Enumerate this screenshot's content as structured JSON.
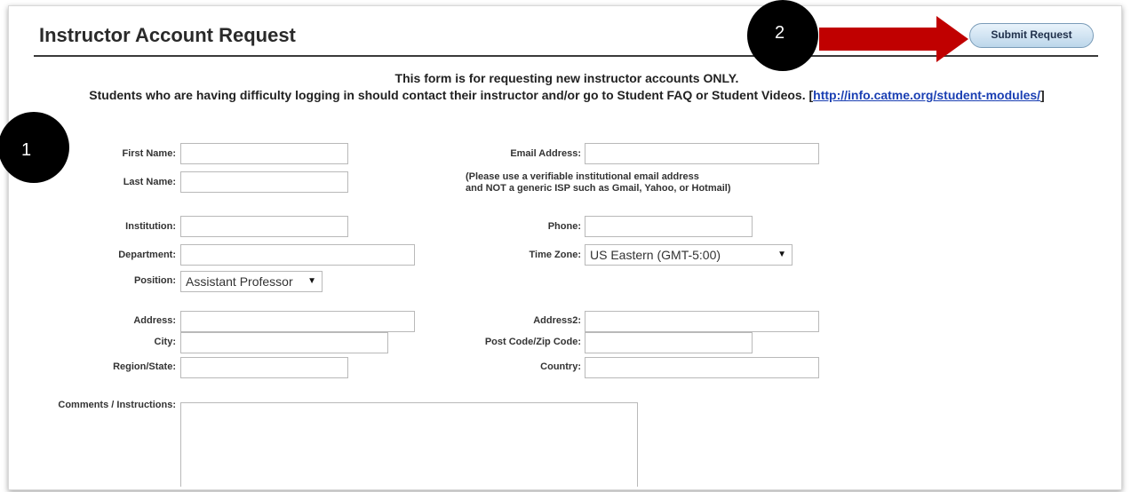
{
  "header": {
    "title": "Instructor Account Request",
    "submit_label": "Submit Request"
  },
  "callouts": {
    "one": "1",
    "two": "2",
    "arrow_color": "#c00000"
  },
  "notice": {
    "line1": "This form is for requesting new instructor accounts ONLY.",
    "line2": "Students who are having difficulty logging in should contact their instructor and/or go to Student FAQ or Student Videos. [",
    "link": "http://info.catme.org/student-modules/",
    "close": "]"
  },
  "form": {
    "first_name": "First Name:",
    "last_name": "Last Name:",
    "email": "Email Address:",
    "email_note_1": "(Please use a verifiable institutional email address",
    "email_note_2": "and NOT a generic ISP such as Gmail, Yahoo, or Hotmail)",
    "institution": "Institution:",
    "phone": "Phone:",
    "department": "Department:",
    "time_zone": "Time Zone:",
    "time_zone_value": "US Eastern (GMT-5:00)",
    "position": "Position:",
    "position_value": "Assistant Professor",
    "address": "Address:",
    "address2": "Address2:",
    "city": "City:",
    "postcode": "Post Code/Zip Code:",
    "region": "Region/State:",
    "country": "Country:",
    "comments": "Comments / Instructions:"
  }
}
